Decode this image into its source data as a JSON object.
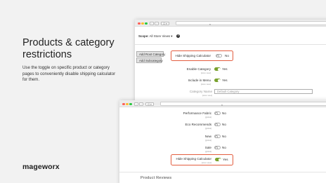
{
  "promo": {
    "headline": "Products & category restrictions",
    "description": "Use the toggle on specific product or category pages to conveniently disable shipping calculator for them.",
    "brand": "mageworx"
  },
  "browser_top": {
    "nav_back": "‹",
    "nav_forward": "›",
    "tab_overview": "⊡ ▾",
    "addr_icon": "◐"
  },
  "browser_bottom": {
    "nav_back": "‹",
    "nav_forward": "›",
    "tab_overview": "⊡ ▾",
    "addr_icon": "◐"
  },
  "category_page": {
    "scope_label": "Scope:",
    "scope_value": "All Store Views ▾",
    "help": "?",
    "add_root_category": "Add Root Category",
    "add_subcategory": "Add Subcategory",
    "hide_shipping_calculator": {
      "label": "Hide Shipping Calculator",
      "state": "No"
    },
    "enable_category": {
      "label": "Enable Category",
      "scope": "[store view]",
      "state": "Yes"
    },
    "include_in_menu": {
      "label": "Include in Menu",
      "scope": "[store view]",
      "state": "Yes"
    },
    "category_name": {
      "label": "Category Name",
      "scope": "[store view]",
      "placeholder": "Default Category"
    }
  },
  "product_page": {
    "rows": [
      {
        "label": "Performance Fabric",
        "scope": "[global]",
        "state": "No"
      },
      {
        "label": "Eco Recommends",
        "scope": "[global]",
        "state": "No"
      },
      {
        "label": "New",
        "scope": "[global]",
        "state": "No"
      },
      {
        "label": "Sale",
        "scope": "[global]",
        "state": "No"
      }
    ],
    "hide_shipping_calculator": {
      "label": "Hide Shipping Calculator",
      "scope": "[store view]",
      "state": "Yes"
    },
    "section": "Product Reviews"
  },
  "colors": {
    "toggle_on": "#79a22e",
    "highlight": "#e35d3f",
    "background": "#f2f2f2"
  }
}
